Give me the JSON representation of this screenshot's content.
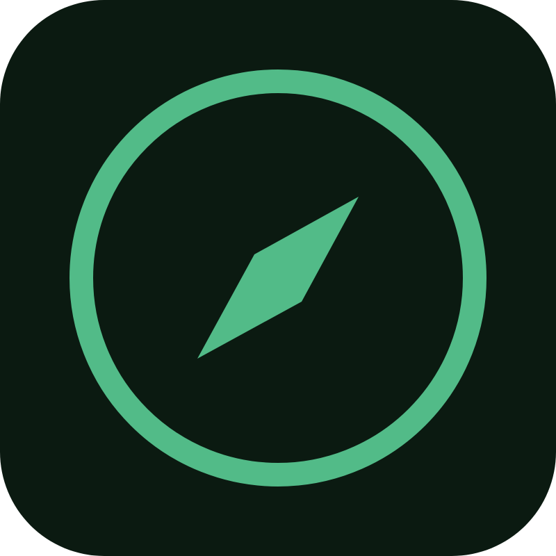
{
  "icon": {
    "name": "compass-icon",
    "background_color": "#0b1a11",
    "accent_color": "#52bb88"
  }
}
